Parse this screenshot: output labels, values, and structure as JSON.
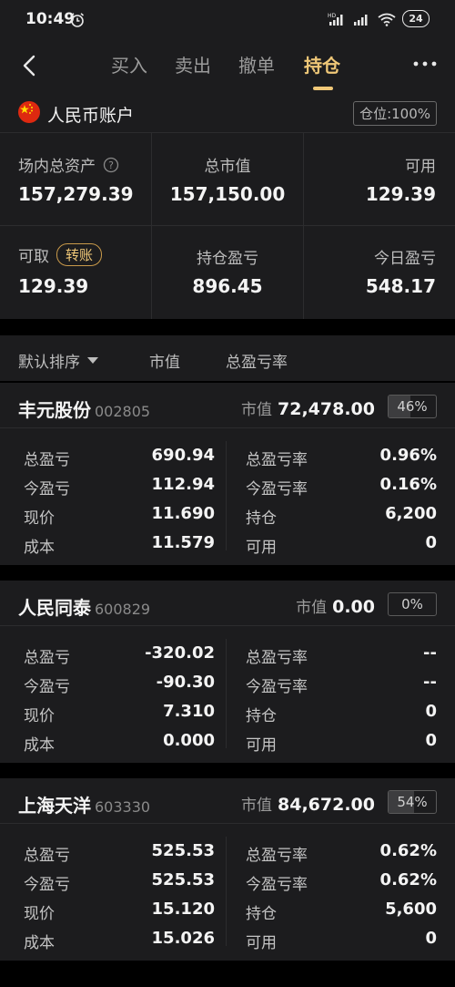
{
  "status_bar": {
    "time": "10:49",
    "battery": "24"
  },
  "nav": {
    "tabs": [
      "买入",
      "卖出",
      "撤单",
      "持仓"
    ],
    "active_tab": "持仓"
  },
  "account": {
    "name": "人民币账户",
    "position_badge": "仓位:100%",
    "total_assets_label": "场内总资产",
    "total_assets": "157,279.39",
    "market_value_label": "总市值",
    "market_value": "157,150.00",
    "available_label": "可用",
    "available": "129.39",
    "withdrawable_label": "可取",
    "transfer_button": "转账",
    "withdrawable": "129.39",
    "position_pl_label": "持仓盈亏",
    "position_pl": "896.45",
    "today_pl_label": "今日盈亏",
    "today_pl": "548.17"
  },
  "sort_bar": {
    "default_sort": "默认排序",
    "market_value": "市值",
    "total_pl_rate": "总盈亏率"
  },
  "labels": {
    "market_value": "市值",
    "total_pl": "总盈亏",
    "total_pl_rate": "总盈亏率",
    "today_pl": "今盈亏",
    "today_pl_rate": "今盈亏率",
    "price": "现价",
    "holding": "持仓",
    "cost": "成本",
    "available": "可用"
  },
  "stocks": [
    {
      "name": "丰元股份",
      "code": "002805",
      "market_value": "72,478.00",
      "weight": "46%",
      "weight_fraction": 0.46,
      "total_pl": "690.94",
      "total_pl_rate": "0.96%",
      "today_pl": "112.94",
      "today_pl_rate": "0.16%",
      "price": "11.690",
      "holding": "6,200",
      "cost": "11.579",
      "available": "0",
      "pl_color": "red",
      "rate_color": "red"
    },
    {
      "name": "人民同泰",
      "code": "600829",
      "market_value": "0.00",
      "weight": "0%",
      "weight_fraction": 0,
      "total_pl": "-320.02",
      "total_pl_rate": "--",
      "today_pl": "-90.30",
      "today_pl_rate": "--",
      "price": "7.310",
      "holding": "0",
      "cost": "0.000",
      "available": "0",
      "pl_color": "green",
      "rate_color": "neutral"
    },
    {
      "name": "上海天洋",
      "code": "603330",
      "market_value": "84,672.00",
      "weight": "54%",
      "weight_fraction": 0.54,
      "total_pl": "525.53",
      "total_pl_rate": "0.62%",
      "today_pl": "525.53",
      "today_pl_rate": "0.62%",
      "price": "15.120",
      "holding": "5,600",
      "cost": "15.026",
      "available": "0",
      "pl_color": "red",
      "rate_color": "red"
    }
  ],
  "colors": {
    "up": "#ff4a4a",
    "down": "#22c33a",
    "accent": "#f0c878"
  }
}
